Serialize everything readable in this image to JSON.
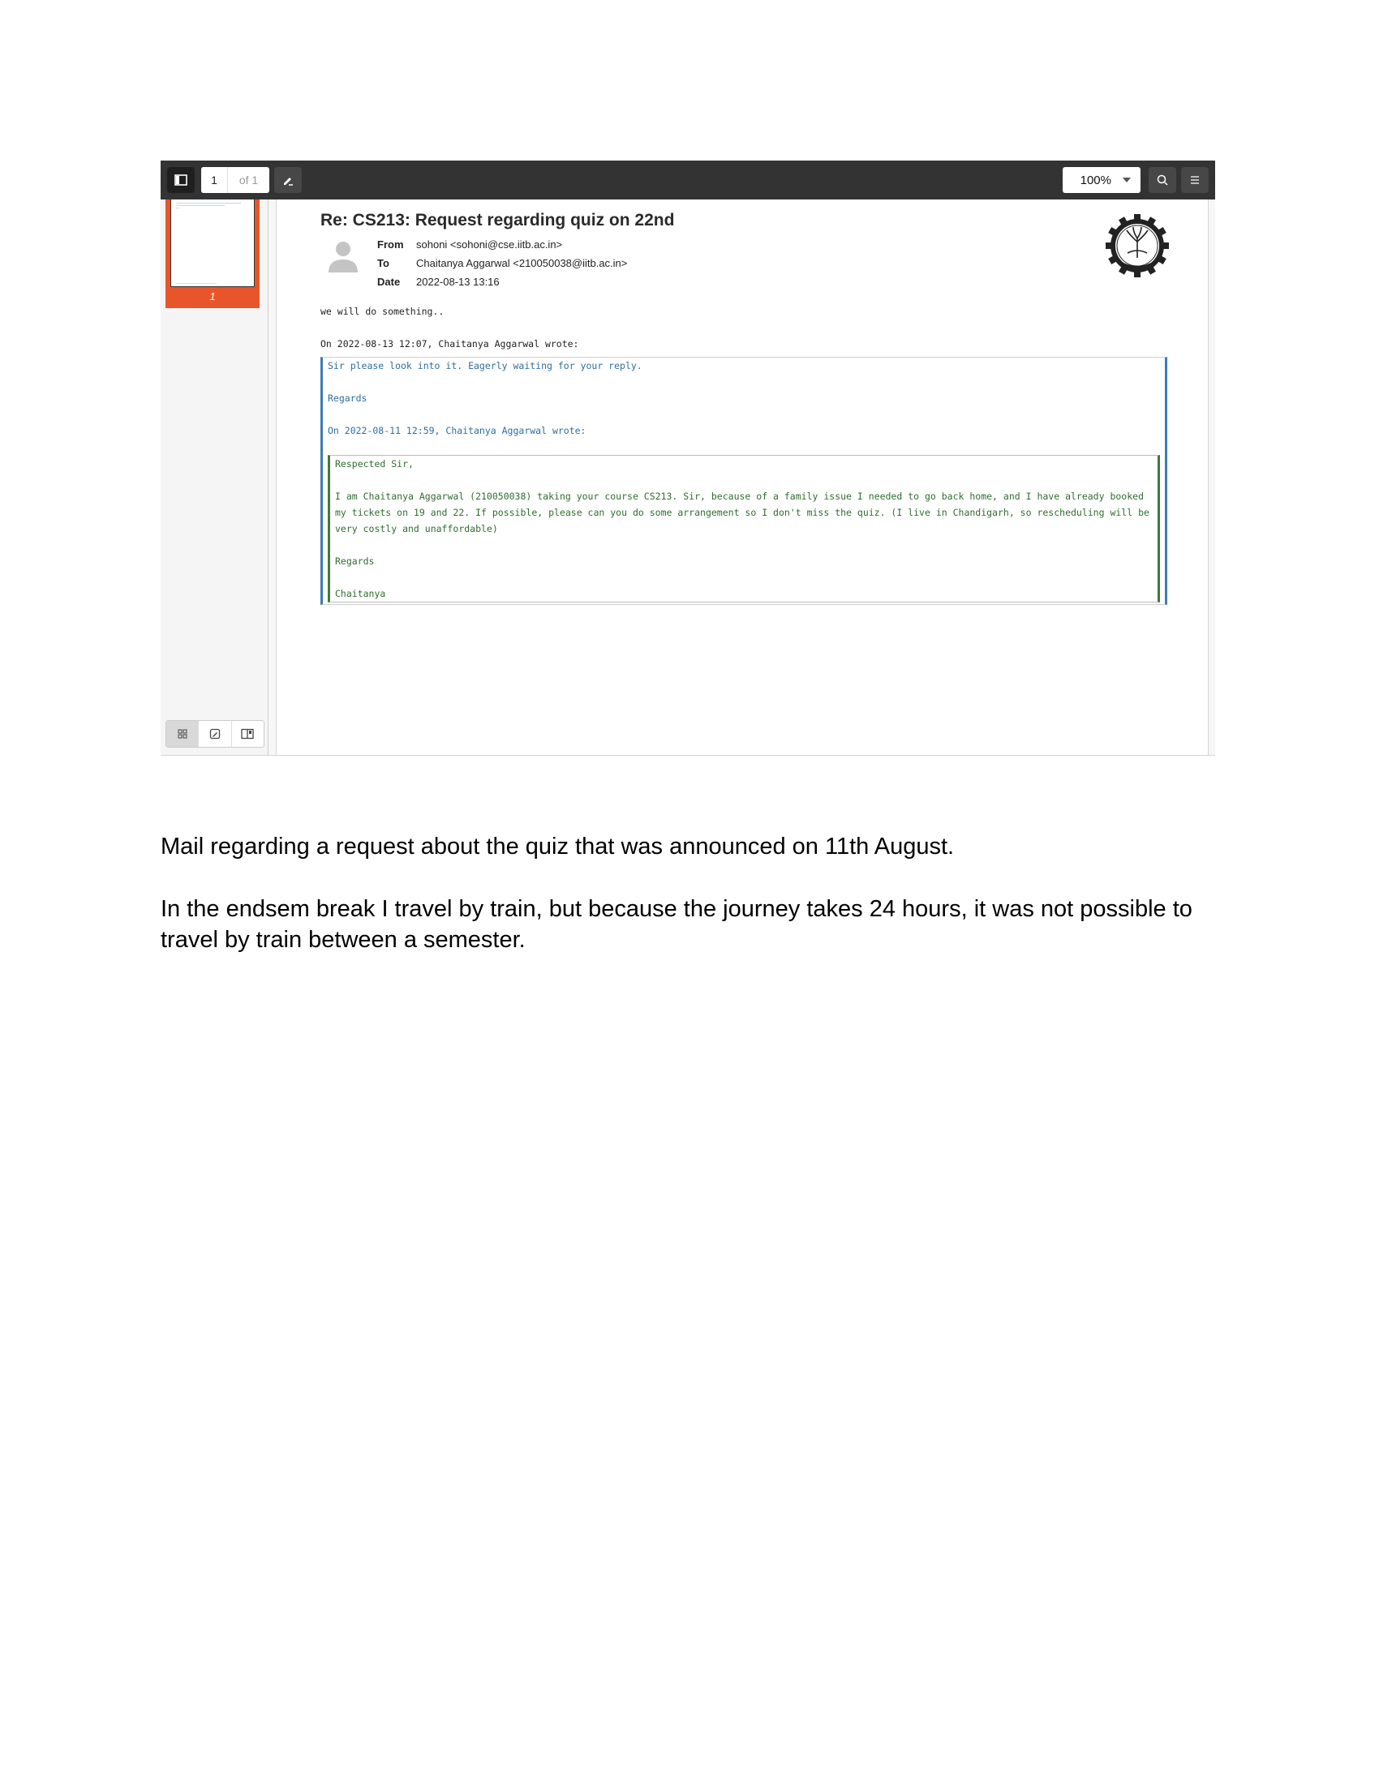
{
  "viewer": {
    "toolbar": {
      "page_current": "1",
      "page_total": "of 1",
      "zoom": "100%",
      "icons": [
        "sidebar-toggle-icon",
        "annotate-pen-icon",
        "search-icon",
        "menu-icon"
      ]
    },
    "sidebar": {
      "thumbnail_label": "1",
      "accent_color": "#e8552a",
      "view_buttons": [
        "thumbnails-grid-icon",
        "annotations-icon",
        "outline-icon"
      ]
    },
    "email": {
      "subject": "Re: CS213: Request regarding quiz on 22nd",
      "from_label": "From",
      "from_value": "sohoni <sohoni@cse.iitb.ac.in>",
      "to_label": "To",
      "to_value": "Chaitanya Aggarwal <210050038@iitb.ac.in>",
      "date_label": "Date",
      "date_value": "2022-08-13 13:16",
      "body": "we will do something..",
      "quote_intro": "On 2022-08-13 12:07, Chaitanya Aggarwal wrote:",
      "quote": {
        "line1": "Sir please look into it. Eagerly waiting for your reply.",
        "regards": "Regards",
        "nested_intro": "On 2022-08-11 12:59, Chaitanya Aggarwal wrote:",
        "nested": {
          "greeting": "Respected Sir,",
          "paragraph": "I am Chaitanya Aggarwal (210050038) taking your course CS213. Sir, because of a family issue I needed to go back home, and I have already booked my tickets on 19 and 22. If possible, please can you do some arrangement so I don't miss the quiz. (I live in Chandigarh, so rescheduling will be very costly and unaffordable)",
          "regards": "Regards",
          "signature": "Chaitanya"
        }
      }
    }
  },
  "caption": {
    "line1": "Mail regarding a request about the quiz that was announced on 11th August.",
    "line2": "In the endsem break I travel by train, but because the journey takes 24 hours, it was not possible to travel by train between a semester."
  }
}
